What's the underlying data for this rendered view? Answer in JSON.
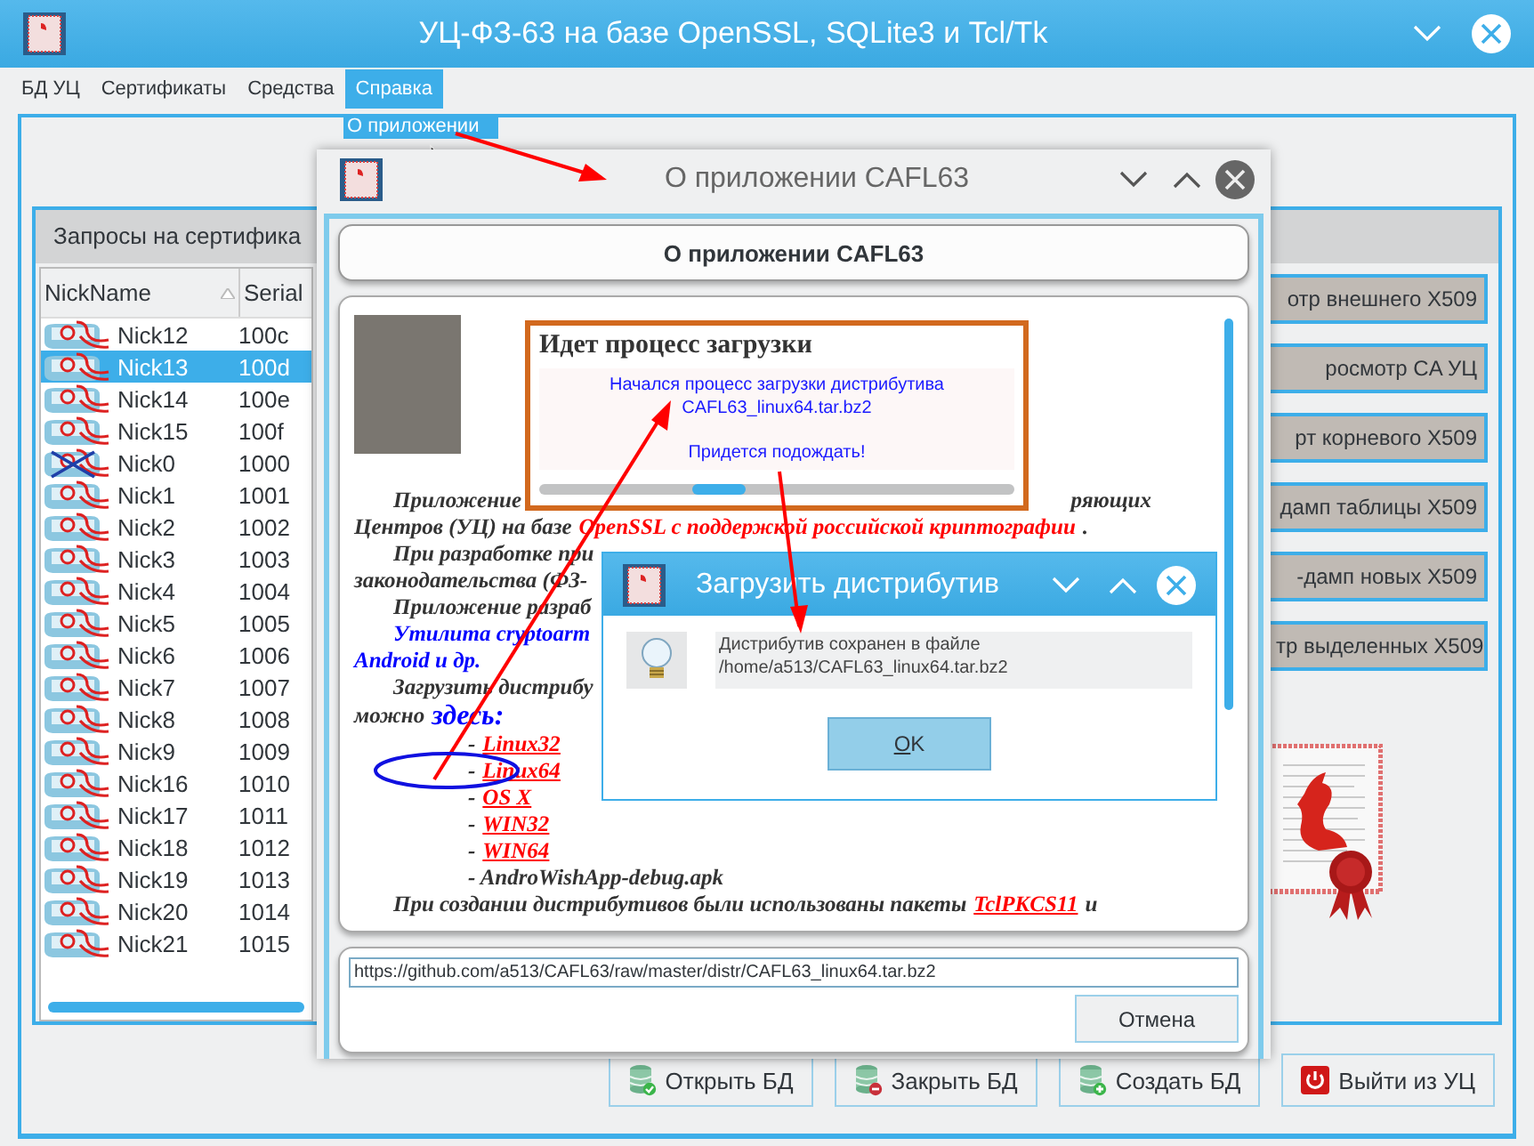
{
  "main_window": {
    "title": "УЦ-ФЗ-63 на базе OpenSSL, SQLite3 и Tcl/Tk",
    "menu": [
      {
        "label": "БД УЦ",
        "selected": false
      },
      {
        "label": "Сертификаты",
        "selected": false
      },
      {
        "label": "Средства",
        "selected": false
      },
      {
        "label": "Справка",
        "selected": true
      }
    ],
    "menu_dropdown": [
      "О приложении"
    ],
    "tab": "Запросы на сертифика",
    "table": {
      "columns": [
        "NickName",
        "Serial"
      ],
      "rows": [
        {
          "nick": "Nick12",
          "serial": "100c",
          "selected": false,
          "revoked": false
        },
        {
          "nick": "Nick13",
          "serial": "100d",
          "selected": true,
          "revoked": false
        },
        {
          "nick": "Nick14",
          "serial": "100e",
          "selected": false,
          "revoked": false
        },
        {
          "nick": "Nick15",
          "serial": "100f",
          "selected": false,
          "revoked": false
        },
        {
          "nick": "Nick0",
          "serial": "1000",
          "selected": false,
          "revoked": true
        },
        {
          "nick": "Nick1",
          "serial": "1001",
          "selected": false,
          "revoked": false
        },
        {
          "nick": "Nick2",
          "serial": "1002",
          "selected": false,
          "revoked": false
        },
        {
          "nick": "Nick3",
          "serial": "1003",
          "selected": false,
          "revoked": false
        },
        {
          "nick": "Nick4",
          "serial": "1004",
          "selected": false,
          "revoked": false
        },
        {
          "nick": "Nick5",
          "serial": "1005",
          "selected": false,
          "revoked": false
        },
        {
          "nick": "Nick6",
          "serial": "1006",
          "selected": false,
          "revoked": false
        },
        {
          "nick": "Nick7",
          "serial": "1007",
          "selected": false,
          "revoked": false
        },
        {
          "nick": "Nick8",
          "serial": "1008",
          "selected": false,
          "revoked": false
        },
        {
          "nick": "Nick9",
          "serial": "1009",
          "selected": false,
          "revoked": false
        },
        {
          "nick": "Nick16",
          "serial": "1010",
          "selected": false,
          "revoked": false
        },
        {
          "nick": "Nick17",
          "serial": "1011",
          "selected": false,
          "revoked": false
        },
        {
          "nick": "Nick18",
          "serial": "1012",
          "selected": false,
          "revoked": false
        },
        {
          "nick": "Nick19",
          "serial": "1013",
          "selected": false,
          "revoked": false
        },
        {
          "nick": "Nick20",
          "serial": "1014",
          "selected": false,
          "revoked": false
        },
        {
          "nick": "Nick21",
          "serial": "1015",
          "selected": false,
          "revoked": false
        }
      ]
    },
    "side_buttons": [
      "отр внешнего X509",
      "росмотр CA УЦ",
      "рт корневого X509",
      "дамп таблицы X509",
      "-дамп новых X509",
      "тр выделенных X509"
    ],
    "bottom_buttons": [
      {
        "label": "Открыть БД",
        "kind": "open"
      },
      {
        "label": "Закрыть БД",
        "kind": "close"
      },
      {
        "label": "Создать БД",
        "kind": "create"
      },
      {
        "label": "Выйти из УЦ",
        "kind": "exit"
      }
    ]
  },
  "about_dialog": {
    "title": "О приложении CAFL63",
    "header": "О приложении CAFL63",
    "lines": [
      {
        "kind": "para",
        "segments": [
          {
            "text": "Приложение",
            "kind": "text"
          }
        ],
        "tail": "ряющих"
      },
      {
        "kind": "cont",
        "segments": [
          {
            "text": "Центров (УЦ) на базе ",
            "kind": "text"
          },
          {
            "text": "OpenSSL с поддержкой российской криптографии",
            "kind": "red"
          },
          {
            "text": ".",
            "kind": "text"
          }
        ]
      },
      {
        "kind": "para",
        "segments": [
          {
            "text": "При разработке при",
            "kind": "text"
          }
        ]
      },
      {
        "kind": "cont",
        "segments": [
          {
            "text": "законодательства (ФЗ-",
            "kind": "text"
          }
        ]
      },
      {
        "kind": "para",
        "segments": [
          {
            "text": "Приложение разраб",
            "kind": "text"
          }
        ]
      },
      {
        "kind": "para",
        "segments": [
          {
            "text": "Утилита cryptoarm",
            "kind": "blue"
          }
        ]
      },
      {
        "kind": "cont",
        "segments": [
          {
            "text": "Android и др.",
            "kind": "blue"
          }
        ]
      },
      {
        "kind": "para",
        "segments": [
          {
            "text": "Загрузить дистрибу",
            "kind": "text"
          }
        ]
      },
      {
        "kind": "cont",
        "segments": [
          {
            "text": "можно",
            "kind": "text"
          },
          {
            "text": "здесь:",
            "kind": "big"
          }
        ]
      },
      {
        "kind": "item",
        "segments": [
          {
            "text": "-",
            "kind": "text"
          },
          {
            "text": "Linux32",
            "kind": "link"
          }
        ]
      },
      {
        "kind": "item",
        "segments": [
          {
            "text": "-",
            "kind": "text"
          },
          {
            "text": "Linux64",
            "kind": "link"
          }
        ]
      },
      {
        "kind": "item",
        "segments": [
          {
            "text": "-",
            "kind": "text"
          },
          {
            "text": "OS X",
            "kind": "link"
          }
        ]
      },
      {
        "kind": "item",
        "segments": [
          {
            "text": "-",
            "kind": "text"
          },
          {
            "text": "WIN32",
            "kind": "link"
          }
        ]
      },
      {
        "kind": "item",
        "segments": [
          {
            "text": "-",
            "kind": "text"
          },
          {
            "text": "WIN64",
            "kind": "link"
          }
        ]
      },
      {
        "kind": "item",
        "segments": [
          {
            "text": "- AndroWishApp-debug.apk",
            "kind": "text"
          }
        ]
      },
      {
        "kind": "para",
        "segments": [
          {
            "text": "При создании дистрибутивов были использованы пакеты",
            "kind": "text"
          },
          {
            "text": "TclPKCS11",
            "kind": "link"
          },
          {
            "text": "и",
            "kind": "text"
          }
        ]
      }
    ],
    "url": "https://github.com/a513/CAFL63/raw/master/distr/CAFL63_linux64.tar.bz2",
    "cancel": "Отмена"
  },
  "progress_popup": {
    "title": "Идет процесс загрузки",
    "message": [
      "Начался процесс загрузки дистрибутива",
      "CAFL63_linux64.tar.bz2"
    ],
    "note": "Придется подождать!"
  },
  "save_dialog": {
    "title": "Загрузить дистрибутив",
    "message": [
      "Дистрибутив сохранен в файле",
      "/home/a513/CAFL63_linux64.tar.bz2"
    ],
    "ok": "OK"
  }
}
